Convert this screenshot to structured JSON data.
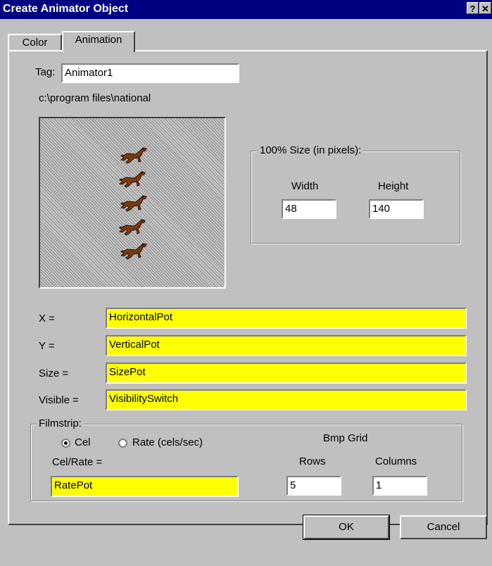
{
  "window": {
    "title": "Create Animator Object",
    "help_glyph": "?",
    "close_glyph": "✕"
  },
  "tabs": [
    {
      "label": "Color",
      "active": false
    },
    {
      "label": "Animation",
      "active": true
    }
  ],
  "tag": {
    "label": "Tag:",
    "value": "Animator1"
  },
  "path": "c:\\program files\\national",
  "preview": {
    "frames": 5
  },
  "size_group": {
    "legend": "100% Size (in pixels):",
    "width_label": "Width",
    "width_value": "48",
    "height_label": "Height",
    "height_value": "140"
  },
  "bindings": [
    {
      "label": "X =",
      "value": "HorizontalPot"
    },
    {
      "label": "Y =",
      "value": "VerticalPot"
    },
    {
      "label": "Size =",
      "value": "SizePot"
    },
    {
      "label": "Visible =",
      "value": "VisibilitySwitch"
    }
  ],
  "filmstrip": {
    "legend": "Filmstrip:",
    "radio_cel": "Cel",
    "radio_rate": "Rate (cels/sec)",
    "selected": "cel",
    "celrate_label": "Cel/Rate =",
    "celrate_value": "RatePot",
    "bmp_grid_label": "Bmp Grid",
    "rows_label": "Rows",
    "rows_value": "5",
    "columns_label": "Columns",
    "columns_value": "1"
  },
  "buttons": {
    "ok": "OK",
    "cancel": "Cancel"
  },
  "colors": {
    "title_bar": "#000080",
    "highlight_field": "#ffff00"
  }
}
